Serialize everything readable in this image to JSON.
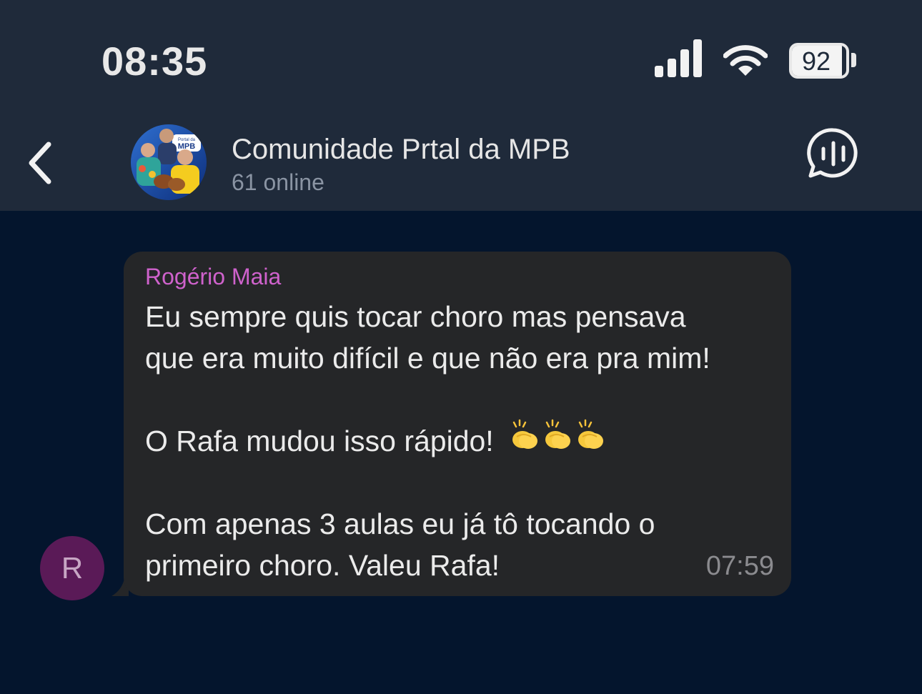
{
  "status_bar": {
    "time": "08:35",
    "battery_level": "92",
    "battery_fraction": 0.92,
    "icons": [
      "cellular-signal-icon",
      "wifi-icon",
      "battery-icon"
    ]
  },
  "header": {
    "back_icon": "chevron-left-icon",
    "title": "Comunidade Prtal da MPB",
    "subtitle": "61 online",
    "voice_chat_icon": "voice-chat-icon",
    "avatar_badge_line1": "Portal da",
    "avatar_badge_line2": "MPB"
  },
  "message": {
    "sender_initial": "R",
    "sender_name": "Rogério Maia",
    "line1": "Eu sempre quis tocar choro mas pensava",
    "line2": "que era muito difícil e que não era pra mim!",
    "line3": "O Rafa mudou isso rápido!",
    "line3_emoji": "clapping-hands-icon x3",
    "line4": "Com apenas 3 aulas eu já tô tocando o",
    "line5": "primeiro choro. Valeu Rafa!",
    "time": "07:59"
  },
  "colors": {
    "header_bg": "#1f2a3a",
    "chat_bg": "#04152d",
    "bubble_bg": "#252628",
    "sender_name": "#cf62cc",
    "avatar_bg": "#5a1a57"
  }
}
